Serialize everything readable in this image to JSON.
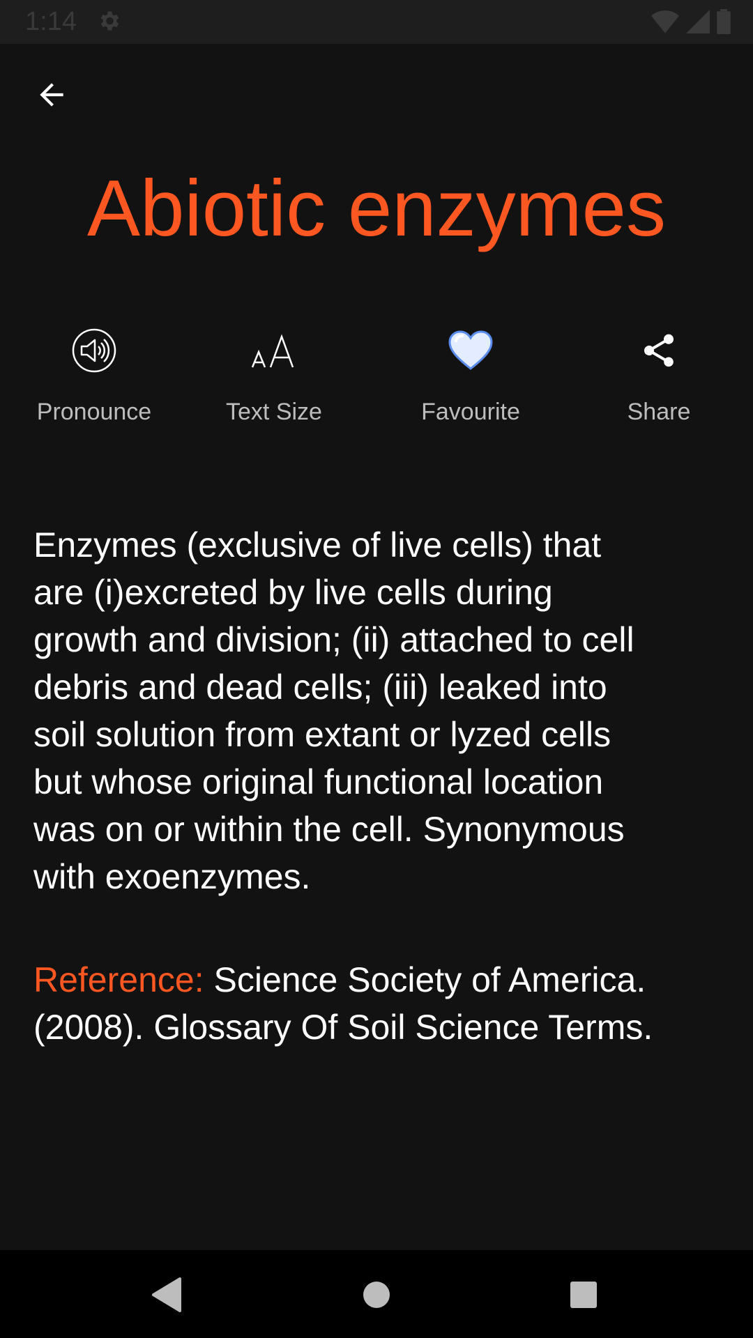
{
  "status_bar": {
    "time": "1:14",
    "icons": [
      "gear-icon",
      "wifi-icon",
      "signal-icon",
      "battery-icon"
    ]
  },
  "header": {
    "back_icon": "arrow-back-icon"
  },
  "title": "Abiotic enzymes",
  "actions": [
    {
      "label": "Pronounce",
      "icon": "speaker-icon"
    },
    {
      "label": "Text Size",
      "icon": "text-size-icon"
    },
    {
      "label": "Favourite",
      "icon": "heart-icon"
    },
    {
      "label": "Share",
      "icon": "share-icon"
    }
  ],
  "definition": {
    "lines": [
      "Enzymes (exclusive of live cells) that",
      "are (i)excreted by live cells during",
      "growth and division; (ii) attached to cell",
      "debris and dead cells; (iii) leaked into",
      "soil solution from extant or lyzed cells",
      "but whose original functional location",
      "was on or within the cell. Synonymous",
      "with exoenzymes."
    ]
  },
  "reference": {
    "label": "Reference:",
    "text": " Science Society of America. (2008). Glossary Of Soil Science Terms."
  },
  "nav": {
    "icons": [
      "nav-back-icon",
      "nav-home-icon",
      "nav-recents-icon"
    ]
  },
  "colors": {
    "accent": "#ff5722",
    "background": "#121212",
    "heart": "#cfe0ff"
  }
}
